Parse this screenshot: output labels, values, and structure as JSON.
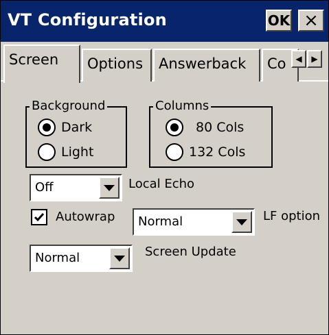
{
  "window": {
    "title": "VT Configuration"
  },
  "titlebar": {
    "ok_label": "OK",
    "close_label": "×"
  },
  "tabs": [
    {
      "label": "Screen"
    },
    {
      "label": "Options"
    },
    {
      "label": "Answerback"
    },
    {
      "label": "Co"
    }
  ],
  "tab_scroll": {
    "left": "◀",
    "right": "▶"
  },
  "background_group": {
    "legend": "Background",
    "options": [
      {
        "label": "Dark",
        "selected": true
      },
      {
        "label": "Light",
        "selected": false
      }
    ]
  },
  "columns_group": {
    "legend": "Columns",
    "options": [
      {
        "label": "80 Cols",
        "selected": true
      },
      {
        "label": "132 Cols",
        "selected": false
      }
    ]
  },
  "local_echo": {
    "value": "Off",
    "label": "Local Echo"
  },
  "autowrap": {
    "label": "Autowrap",
    "checked": true
  },
  "lf_option": {
    "value": "Normal",
    "label": "LF option"
  },
  "screen_update": {
    "value": "Normal",
    "label": "Screen Update"
  },
  "colors": {
    "titlebar": "#08246b",
    "face": "#d4d0c8"
  }
}
